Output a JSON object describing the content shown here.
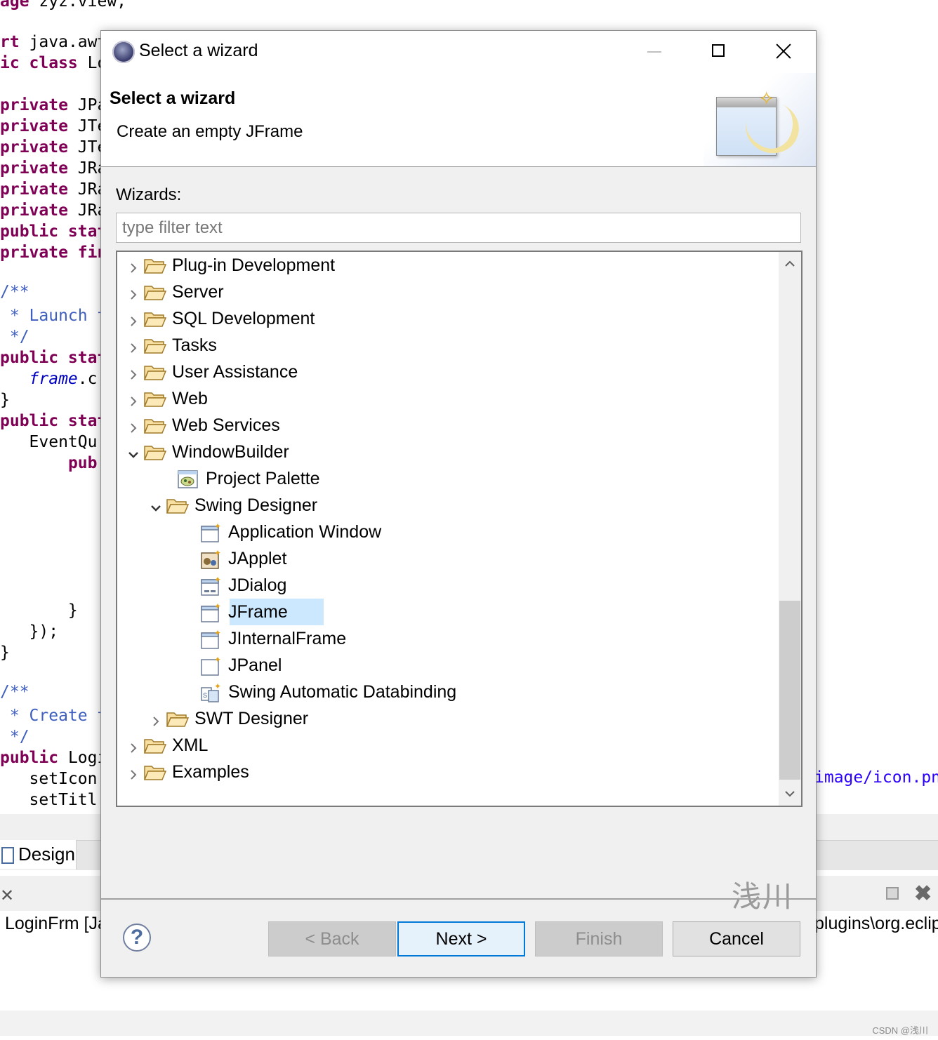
{
  "editor": {
    "lines": [
      {
        "segments": [
          {
            "cls": "kw",
            "text": "age"
          },
          {
            "cls": "",
            "text": " zyz.view;"
          }
        ]
      },
      {
        "segments": [
          {
            "cls": "kw",
            "text": "rt"
          },
          {
            "cls": "",
            "text": " java.awt"
          }
        ]
      },
      {
        "segments": [
          {
            "cls": "kw",
            "text": "ic class"
          },
          {
            "cls": "",
            "text": " Lo"
          }
        ]
      },
      {
        "segments": [
          {
            "cls": "kw",
            "text": "private"
          },
          {
            "cls": "",
            "text": " JPa"
          }
        ]
      },
      {
        "segments": [
          {
            "cls": "kw",
            "text": "private"
          },
          {
            "cls": "",
            "text": " JTe"
          }
        ]
      },
      {
        "segments": [
          {
            "cls": "kw",
            "text": "private"
          },
          {
            "cls": "",
            "text": " JTe"
          }
        ]
      },
      {
        "segments": [
          {
            "cls": "kw",
            "text": "private"
          },
          {
            "cls": "",
            "text": " JRa"
          }
        ]
      },
      {
        "segments": [
          {
            "cls": "kw",
            "text": "private"
          },
          {
            "cls": "",
            "text": " JRa"
          }
        ]
      },
      {
        "segments": [
          {
            "cls": "kw",
            "text": "private"
          },
          {
            "cls": "",
            "text": " JRa"
          }
        ]
      },
      {
        "segments": [
          {
            "cls": "kw",
            "text": "public stat"
          }
        ]
      },
      {
        "segments": [
          {
            "cls": "kw",
            "text": "private fin"
          }
        ]
      },
      {
        "segments": [
          {
            "cls": "cm",
            "text": "/**"
          }
        ]
      },
      {
        "segments": [
          {
            "cls": "cm",
            "text": " * Launch t"
          }
        ]
      },
      {
        "segments": [
          {
            "cls": "cm",
            "text": " */"
          }
        ]
      },
      {
        "segments": [
          {
            "cls": "kw",
            "text": "public stat"
          }
        ]
      },
      {
        "segments": [
          {
            "cls": "",
            "text": "   "
          },
          {
            "cls": "it",
            "text": "frame"
          },
          {
            "cls": "",
            "text": ".c"
          }
        ]
      },
      {
        "segments": [
          {
            "cls": "",
            "text": "}"
          }
        ]
      },
      {
        "segments": [
          {
            "cls": "kw",
            "text": "public stat"
          }
        ]
      },
      {
        "segments": [
          {
            "cls": "",
            "text": "   EventQu"
          }
        ]
      },
      {
        "segments": [
          {
            "cls": "",
            "text": "       "
          },
          {
            "cls": "kw",
            "text": "pub"
          }
        ]
      },
      {
        "segments": [
          {
            "cls": "",
            "text": "       }"
          }
        ]
      },
      {
        "segments": [
          {
            "cls": "",
            "text": "   });"
          }
        ]
      },
      {
        "segments": [
          {
            "cls": "",
            "text": "}"
          }
        ]
      },
      {
        "segments": [
          {
            "cls": "cm",
            "text": "/**"
          }
        ]
      },
      {
        "segments": [
          {
            "cls": "cm",
            "text": " * Create t"
          }
        ]
      },
      {
        "segments": [
          {
            "cls": "cm",
            "text": " */"
          }
        ]
      },
      {
        "segments": [
          {
            "cls": "kw",
            "text": "public"
          },
          {
            "cls": "",
            "text": " Logi"
          }
        ]
      },
      {
        "segments": [
          {
            "cls": "",
            "text": "   setIcon"
          }
        ]
      },
      {
        "segments": [
          {
            "cls": "",
            "text": "   setTitl"
          }
        ]
      }
    ],
    "right_snippet": "image/icon.pn"
  },
  "bottom": {
    "design_tab": "Design",
    "console_label": "LoginFrm [Ja",
    "path_fragment": "plugins\\org.eclip",
    "csdn": "CSDN @浅川"
  },
  "dialog": {
    "title": "Select a wizard",
    "banner_title": "Select a wizard",
    "banner_description": "Create an empty JFrame",
    "wizards_label": "Wizards:",
    "filter_placeholder": "type filter text",
    "filter_value": "",
    "tree": [
      {
        "label": "Plug-in Development",
        "level": 0,
        "kind": "folder",
        "state": "collapsed",
        "selected": false
      },
      {
        "label": "Server",
        "level": 0,
        "kind": "folder",
        "state": "collapsed",
        "selected": false
      },
      {
        "label": "SQL Development",
        "level": 0,
        "kind": "folder",
        "state": "collapsed",
        "selected": false
      },
      {
        "label": "Tasks",
        "level": 0,
        "kind": "folder",
        "state": "collapsed",
        "selected": false
      },
      {
        "label": "User Assistance",
        "level": 0,
        "kind": "folder",
        "state": "collapsed",
        "selected": false
      },
      {
        "label": "Web",
        "level": 0,
        "kind": "folder",
        "state": "collapsed",
        "selected": false
      },
      {
        "label": "Web Services",
        "level": 0,
        "kind": "folder",
        "state": "collapsed",
        "selected": false
      },
      {
        "label": "WindowBuilder",
        "level": 0,
        "kind": "folder",
        "state": "expanded",
        "selected": false
      },
      {
        "label": "Project Palette",
        "level": 1,
        "kind": "palette",
        "state": "leaf",
        "selected": false
      },
      {
        "label": "Swing Designer",
        "level": 1,
        "kind": "folder",
        "state": "expanded",
        "selected": false
      },
      {
        "label": "Application Window",
        "level": 2,
        "kind": "window",
        "state": "leaf",
        "selected": false
      },
      {
        "label": "JApplet",
        "level": 2,
        "kind": "applet",
        "state": "leaf",
        "selected": false
      },
      {
        "label": "JDialog",
        "level": 2,
        "kind": "dialog",
        "state": "leaf",
        "selected": false
      },
      {
        "label": "JFrame",
        "level": 2,
        "kind": "window",
        "state": "leaf",
        "selected": true
      },
      {
        "label": "JInternalFrame",
        "level": 2,
        "kind": "window",
        "state": "leaf",
        "selected": false
      },
      {
        "label": "JPanel",
        "level": 2,
        "kind": "panel",
        "state": "leaf",
        "selected": false
      },
      {
        "label": "Swing Automatic Databinding",
        "level": 2,
        "kind": "binding",
        "state": "leaf",
        "selected": false
      },
      {
        "label": "SWT Designer",
        "level": 1,
        "kind": "folder",
        "state": "collapsed",
        "selected": false
      },
      {
        "label": "XML",
        "level": 0,
        "kind": "folder",
        "state": "collapsed",
        "selected": false
      },
      {
        "label": "Examples",
        "level": 0,
        "kind": "folder",
        "state": "collapsed",
        "selected": false
      }
    ],
    "ime_watermark": "浅川",
    "buttons": {
      "back": "< Back",
      "next": "Next >",
      "finish": "Finish",
      "cancel": "Cancel"
    },
    "help_glyph": "?"
  },
  "colors": {
    "selection": "#cce8ff",
    "default_button_border": "#0078d7",
    "keyword": "#7f0055",
    "comment": "#3f5fbf"
  }
}
